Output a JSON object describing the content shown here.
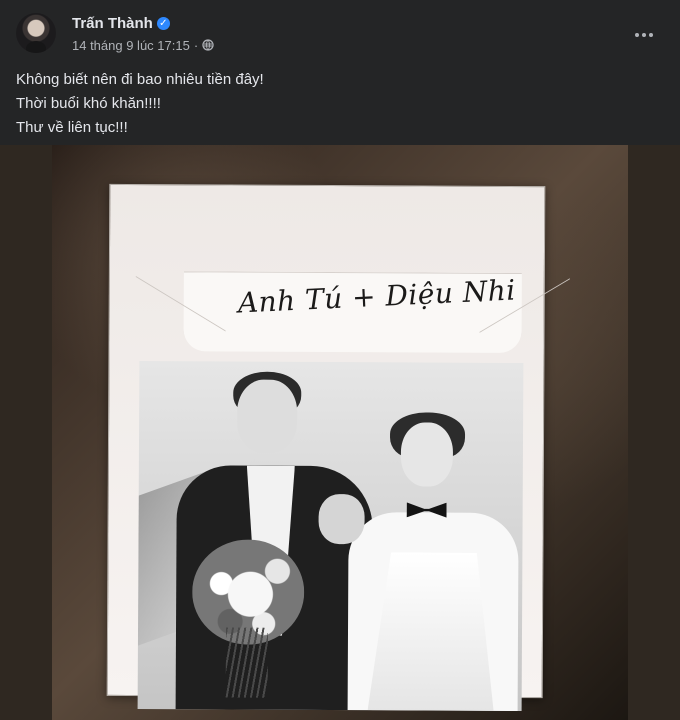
{
  "post": {
    "author_name": "Trấn Thành",
    "timestamp": "14 tháng 9 lúc 17:15",
    "separator": "·",
    "privacy_icon": "globe-icon",
    "verified_icon": "verified-badge-icon",
    "more_icon": "more-options-icon",
    "caption": [
      "Không biết nên đi bao nhiêu tiền đây!",
      "Thời buổi khó khăn!!!!",
      "Thư về liên tục!!!"
    ],
    "verified_mark": "✓"
  },
  "photo": {
    "card_names": "Anh Tú + Diệu Nhi"
  }
}
